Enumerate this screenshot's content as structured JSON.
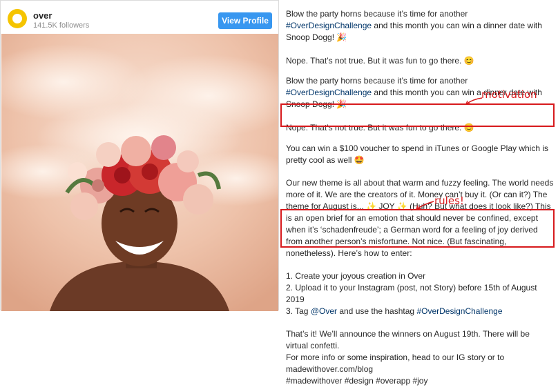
{
  "post": {
    "username": "over",
    "followers": "141.5K followers",
    "view_profile": "View Profile"
  },
  "caption": {
    "p1": "Blow the party horns because it’s time for another ",
    "tag_challenge": "#OverDesignChallenge",
    "p1b": " and this month you can win a dinner date with Snoop Dogg! 🎉",
    "p2": "Nope. That’s not true. But it was fun to go there. 😊",
    "p3": "Blow the party horns because it’s time for another ",
    "p3b": " and this month you can win a dinner date with Snoop Dogg! 🎉",
    "p4": "Nope. That’s not true. But it was fun to go there. 😊",
    "motivation_text": "You can win a $100 voucher to spend in iTunes or Google Play which is pretty cool as well 🤩",
    "theme": "Our new theme is all about that warm and fuzzy feeling. The world needs more of it. We are the creators of it. Money can’t buy it. (Or can it?) The theme for August is... ✨ JOY ✨ (Huh? But what does it look like?) This is an open brief for an emotion that should never be confined, except when it’s ‘schadenfreude’; a German word for a feeling of joy derived from another person’s misfortune. Not nice. (But fascinating, nonetheless). Here’s how to enter:",
    "rule1": "1. Create your joyous creation in Over",
    "rule2": "2. Upload it to your Instagram (post, not Story) before 15th of August 2019",
    "rule3a": "3. Tag ",
    "rule3_mention": "@Over",
    "rule3b": " and use the hashtag ",
    "outro1": "That’s it! We’ll announce the winners on August 19th. There will be virtual confetti.",
    "outro2": "For more info or some inspiration, head to our IG story or to madewithover.com/blog",
    "hashtags": "#madewithover #design #overapp #joy"
  },
  "annotations": {
    "motivation": "motivation",
    "rules": "rules!"
  },
  "colors": {
    "accent_blue": "#3897f0",
    "annotation_red": "#d7191c",
    "hashtag": "#003569"
  }
}
